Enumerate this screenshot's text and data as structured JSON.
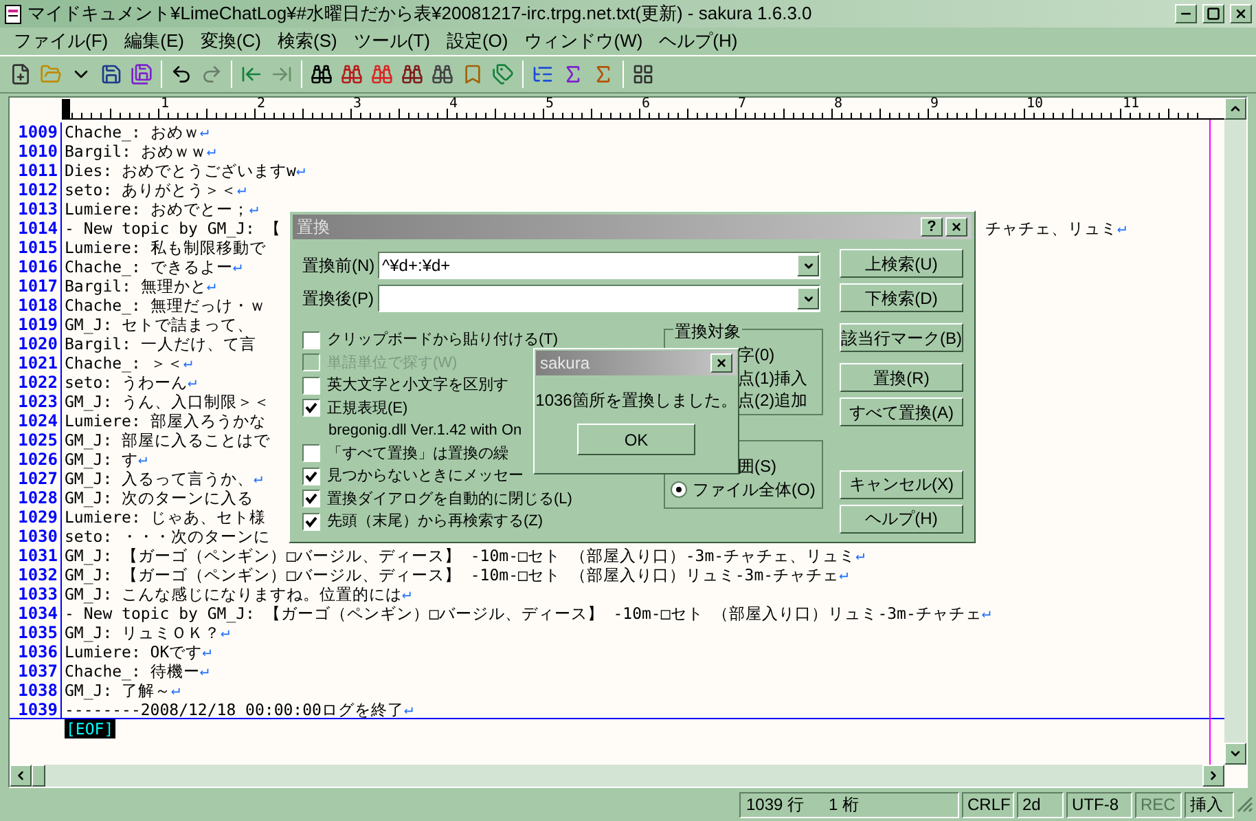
{
  "window": {
    "title": "マイドキュメント¥LimeChatLog¥#水曜日だから表¥20081217-irc.trpg.net.txt(更新) - sakura 1.6.3.0"
  },
  "menu": [
    "ファイル(F)",
    "編集(E)",
    "変換(C)",
    "検索(S)",
    "ツール(T)",
    "設定(O)",
    "ウィンドウ(W)",
    "ヘルプ(H)"
  ],
  "ruler": [
    "1",
    "2",
    "3",
    "4",
    "5",
    "6",
    "7",
    "8",
    "9",
    "10",
    "11"
  ],
  "editor": {
    "eof": "[EOF]",
    "lines": [
      {
        "number": "1009",
        "text": "Chache_: おめｗ",
        "eol": "↵"
      },
      {
        "number": "1010",
        "text": "Bargil: おめｗｗ",
        "eol": "↵"
      },
      {
        "number": "1011",
        "text": "Dies: おめでとうございますw",
        "eol": "↵"
      },
      {
        "number": "1012",
        "text": "seto: ありがとう＞＜",
        "eol": "↵"
      },
      {
        "number": "1013",
        "text": "Lumiere: おめでとー；",
        "eol": "↵"
      },
      {
        "number": "1014",
        "text": "- New topic by GM_J: 【",
        "tail": "チャチェ、リュミ",
        "eol": "↵"
      },
      {
        "number": "1015",
        "text": "Lumiere: 私も制限移動で"
      },
      {
        "number": "1016",
        "text": "Chache_: できるよー",
        "eol": "↵"
      },
      {
        "number": "1017",
        "text": "Bargil: 無理かと",
        "eol": "↵"
      },
      {
        "number": "1018",
        "text": "Chache_: 無理だっけ・ｗ"
      },
      {
        "number": "1019",
        "text": "GM_J: セトで詰まって、"
      },
      {
        "number": "1020",
        "text": "Bargil: 一人だけ、て言"
      },
      {
        "number": "1021",
        "text": "Chache_: ＞＜",
        "eol": "↵"
      },
      {
        "number": "1022",
        "text": "seto: うわーん",
        "eol": "↵"
      },
      {
        "number": "1023",
        "text": "GM_J: うん、入口制限＞＜"
      },
      {
        "number": "1024",
        "text": "Lumiere: 部屋入ろうかな"
      },
      {
        "number": "1025",
        "text": "GM_J: 部屋に入ることはで"
      },
      {
        "number": "1026",
        "text": "GM_J: す",
        "eol": "↵"
      },
      {
        "number": "1027",
        "text": "GM_J: 入るって言うか、",
        "eol": "↵"
      },
      {
        "number": "1028",
        "text": "GM_J: 次のターンに入る"
      },
      {
        "number": "1029",
        "text": "Lumiere: じゃあ、セト様"
      },
      {
        "number": "1030",
        "text": "seto: ・・・次のターンに"
      },
      {
        "number": "1031",
        "text": "GM_J: 【ガーゴ（ペンギン）□バージル、ディース】 -10m-□セト （部屋入り口）-3m-チャチェ、リュミ",
        "eol": "↵"
      },
      {
        "number": "1032",
        "text": "GM_J: 【ガーゴ（ペンギン）□バージル、ディース】 -10m-□セト （部屋入り口）リュミ-3m-チャチェ",
        "eol": "↵"
      },
      {
        "number": "1033",
        "text": "GM_J: こんな感じになりますね。位置的には",
        "eol": "↵"
      },
      {
        "number": "1034",
        "text": "- New topic by GM_J: 【ガーゴ（ペンギン）□バージル、ディース】 -10m-□セト （部屋入り口）リュミ-3m-チャチェ",
        "eol": "↵"
      },
      {
        "number": "1035",
        "text": "GM_J: リュミＯＫ？",
        "eol": "↵"
      },
      {
        "number": "1036",
        "text": "Lumiere: OKです",
        "eol": "↵"
      },
      {
        "number": "1037",
        "text": "Chache_: 待機ー",
        "eol": "↵"
      },
      {
        "number": "1038",
        "text": "GM_J: 了解～",
        "eol": "↵"
      },
      {
        "number": "1039",
        "text": "--------2008/12/18 00:00:00ログを終了",
        "eol": "↵"
      }
    ]
  },
  "status_bar": {
    "line": "1039 行",
    "column": "1 桁",
    "newline": "CRLF",
    "code": "2d",
    "encoding": "UTF-8",
    "rec": {
      "text": "REC",
      "disabled": true
    },
    "mode": "挿入"
  },
  "dialog": {
    "title": "置換",
    "help": "?",
    "close": "×",
    "fields": [
      {
        "label": "置換前(N)",
        "value": "^¥d+:¥d+"
      },
      {
        "label": "置換後(P)"
      }
    ],
    "options": [
      {
        "kind": "checkbox",
        "label": "クリップボードから貼り付ける(T)",
        "checked": false,
        "disabled": false
      },
      {
        "kind": "checkbox",
        "label": "単語単位で探す(W)",
        "checked": false,
        "disabled": true
      },
      {
        "kind": "checkbox",
        "label": "英大文字と小文字を区別す",
        "checked": false,
        "disabled": false
      },
      {
        "kind": "checkbox",
        "label": "正規表現(E)",
        "checked": true,
        "disabled": false
      },
      {
        "kind": "note",
        "label": "bregonig.dll Ver.1.42 with On"
      },
      {
        "kind": "checkbox",
        "label": "「すべて置換」は置換の繰",
        "checked": false,
        "disabled": false
      },
      {
        "kind": "checkbox",
        "label": "見つからないときにメッセー",
        "checked": true,
        "disabled": false
      },
      {
        "kind": "checkbox",
        "label": "置換ダイアログを自動的に閉じる(L)",
        "checked": true,
        "disabled": false
      },
      {
        "kind": "checkbox",
        "label": "先頭（末尾）から再検索する(Z)",
        "checked": true,
        "disabled": false
      }
    ],
    "target_group": {
      "title": "置換対象",
      "items": [
        {
          "kind": "fragment",
          "label": "字(0)"
        },
        {
          "kind": "fragment",
          "label": "点(1)挿入"
        },
        {
          "kind": "fragment",
          "label": "点(2)追加"
        }
      ]
    },
    "scope_group": {
      "items": [
        {
          "kind": "fragment",
          "label": "囲(S)"
        },
        {
          "kind": "radio",
          "label": "ファイル全体(O)",
          "selected": true
        }
      ]
    },
    "button_groups": [
      [
        "上検索(U)",
        "下検索(D)"
      ],
      [
        "該当行マーク(B)"
      ],
      [
        "置換(R)",
        "すべて置換(A)"
      ],
      [
        "キャンセル(X)",
        "ヘルプ(H)"
      ]
    ]
  },
  "message_box": {
    "title": "sakura",
    "close": "×",
    "message": "1036箇所を置換しました。",
    "button": "OK"
  }
}
